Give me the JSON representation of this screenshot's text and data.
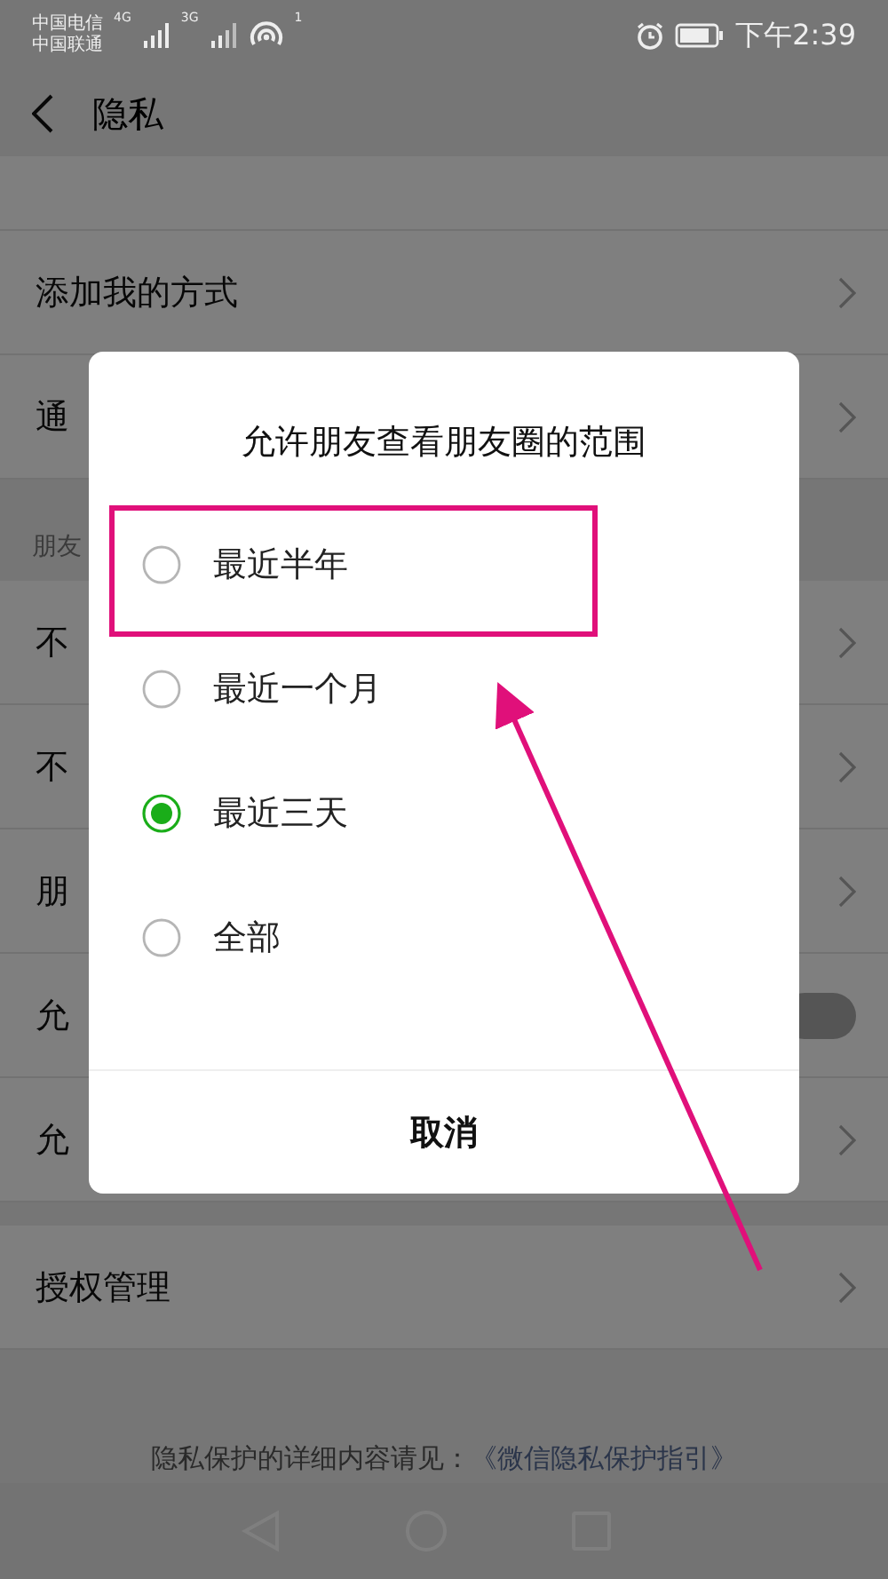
{
  "status_bar": {
    "carriers": [
      "中国电信",
      "中国联通"
    ],
    "network_labels": [
      "4G",
      "3G"
    ],
    "hotspot_count": "1",
    "time": "下午2:39"
  },
  "header": {
    "title": "隐私"
  },
  "settings": [
    {
      "kind": "row",
      "label": "添加我的方式"
    },
    {
      "kind": "row",
      "label": "通"
    },
    {
      "kind": "section",
      "label": "朋友"
    },
    {
      "kind": "row",
      "label": "不"
    },
    {
      "kind": "row",
      "label": "不"
    },
    {
      "kind": "row",
      "label": "朋"
    },
    {
      "kind": "toggle",
      "label": "允",
      "on": false
    },
    {
      "kind": "row",
      "label": "允"
    },
    {
      "kind": "gap"
    },
    {
      "kind": "row",
      "label": "授权管理"
    }
  ],
  "footer": {
    "text": "隐私保护的详细内容请见：",
    "link": "《微信隐私保护指引》"
  },
  "dialog": {
    "title": "允许朋友查看朋友圈的范围",
    "options": [
      {
        "label": "最近半年",
        "selected": false
      },
      {
        "label": "最近一个月",
        "selected": false
      },
      {
        "label": "最近三天",
        "selected": true
      },
      {
        "label": "全部",
        "selected": false
      }
    ],
    "cancel": "取消"
  }
}
